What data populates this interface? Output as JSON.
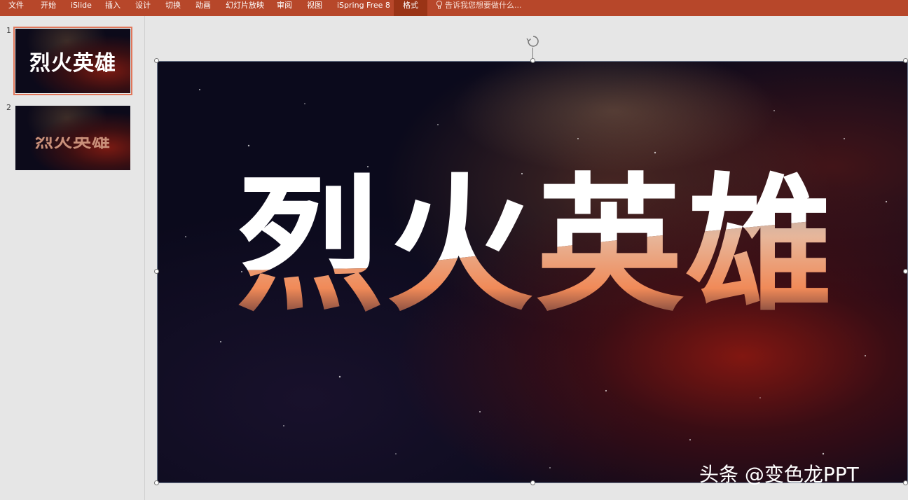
{
  "ribbon": {
    "tabs": [
      "文件",
      "开始",
      "iSlide",
      "插入",
      "设计",
      "切换",
      "动画",
      "幻灯片放映",
      "审阅",
      "视图",
      "iSpring Free 8",
      "格式"
    ],
    "active_tab": "格式",
    "tell_me": "告诉我您想要做什么..."
  },
  "thumbnails": [
    {
      "number": "1",
      "title": "烈火英雄",
      "selected": true
    },
    {
      "number": "2",
      "title": "烈火英雄",
      "selected": false
    }
  ],
  "slide": {
    "title": "烈火英雄"
  },
  "watermark": "头条 @变色龙PPT",
  "colors": {
    "ribbon": "#b7472a",
    "active_tab": "#9a3416",
    "selection_outline": "#e0765a",
    "slide_bg": "#0b0a1c"
  },
  "icons": {
    "tell_me": "lightbulb-icon",
    "rotate": "rotate-icon"
  }
}
